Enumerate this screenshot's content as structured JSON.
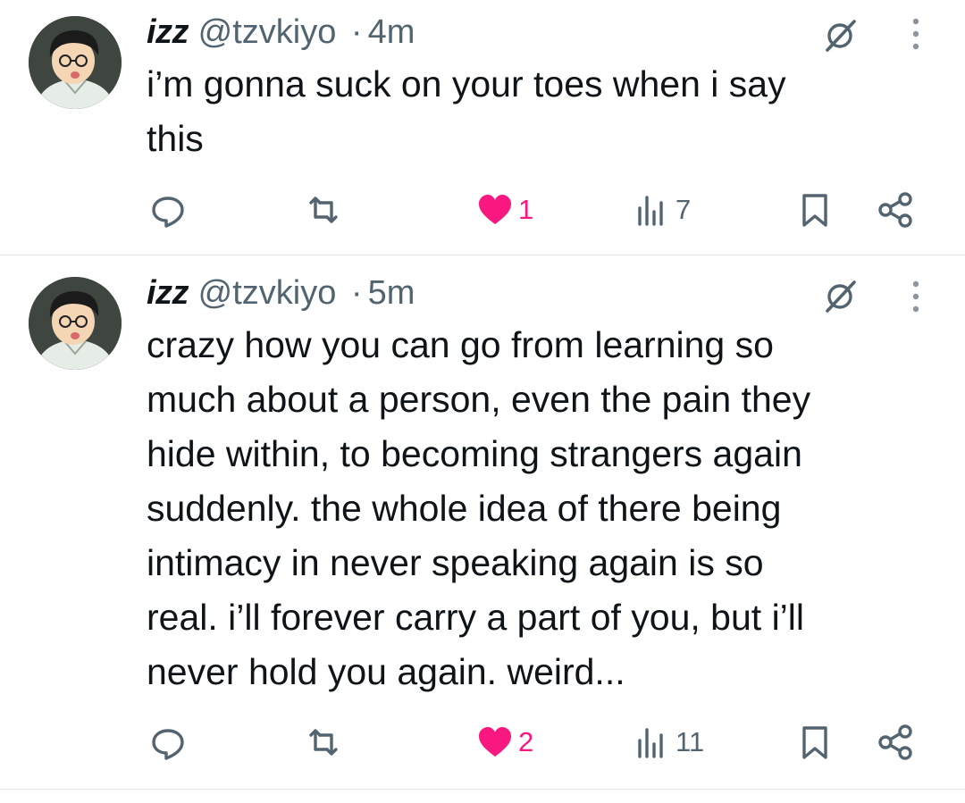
{
  "colors": {
    "like": "#f91880",
    "icon": "#536471",
    "text": "#0f1419",
    "divider": "#e6e8eb"
  },
  "tweets": [
    {
      "name": "izz",
      "handle": "@tzvkiyo",
      "separator": "·",
      "time": "4m",
      "text": "i’m gonna suck on your toes when i say\nthis",
      "likes": "1",
      "views": "7",
      "icons": [
        "reply-icon",
        "retweet-icon",
        "heart-filled-icon",
        "views-icon",
        "bookmark-icon",
        "share-icon",
        "grok-icon",
        "more-icon"
      ]
    },
    {
      "name": "izz",
      "handle": "@tzvkiyo",
      "separator": "·",
      "time": "5m",
      "text": "crazy how you can go from learning so\nmuch about a person, even the pain they\nhide within, to becoming strangers again\nsuddenly. the whole idea of there being\nintimacy in never speaking again is so\nreal. i’ll forever carry a part of you, but i’ll\nnever hold you again. weird...",
      "likes": "2",
      "views": "11",
      "icons": [
        "reply-icon",
        "retweet-icon",
        "heart-filled-icon",
        "views-icon",
        "bookmark-icon",
        "share-icon",
        "grok-icon",
        "more-icon"
      ]
    }
  ]
}
